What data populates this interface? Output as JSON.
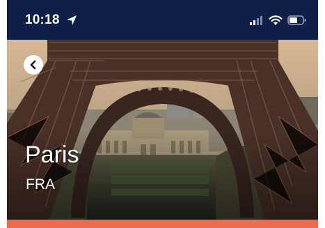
{
  "status_bar": {
    "time": "10:18",
    "icons": [
      "location-arrow-icon",
      "cellular-signal-icon",
      "wifi-icon",
      "battery-icon"
    ]
  },
  "hero": {
    "city": "Paris",
    "country_code": "FRA",
    "image": "eiffel-tower-photo",
    "back_icon": "chevron-left-icon"
  },
  "colors": {
    "status_bar_bg": "#0f1f47",
    "accent": "#ee6a4c",
    "text_on_image": "#ffffff"
  }
}
